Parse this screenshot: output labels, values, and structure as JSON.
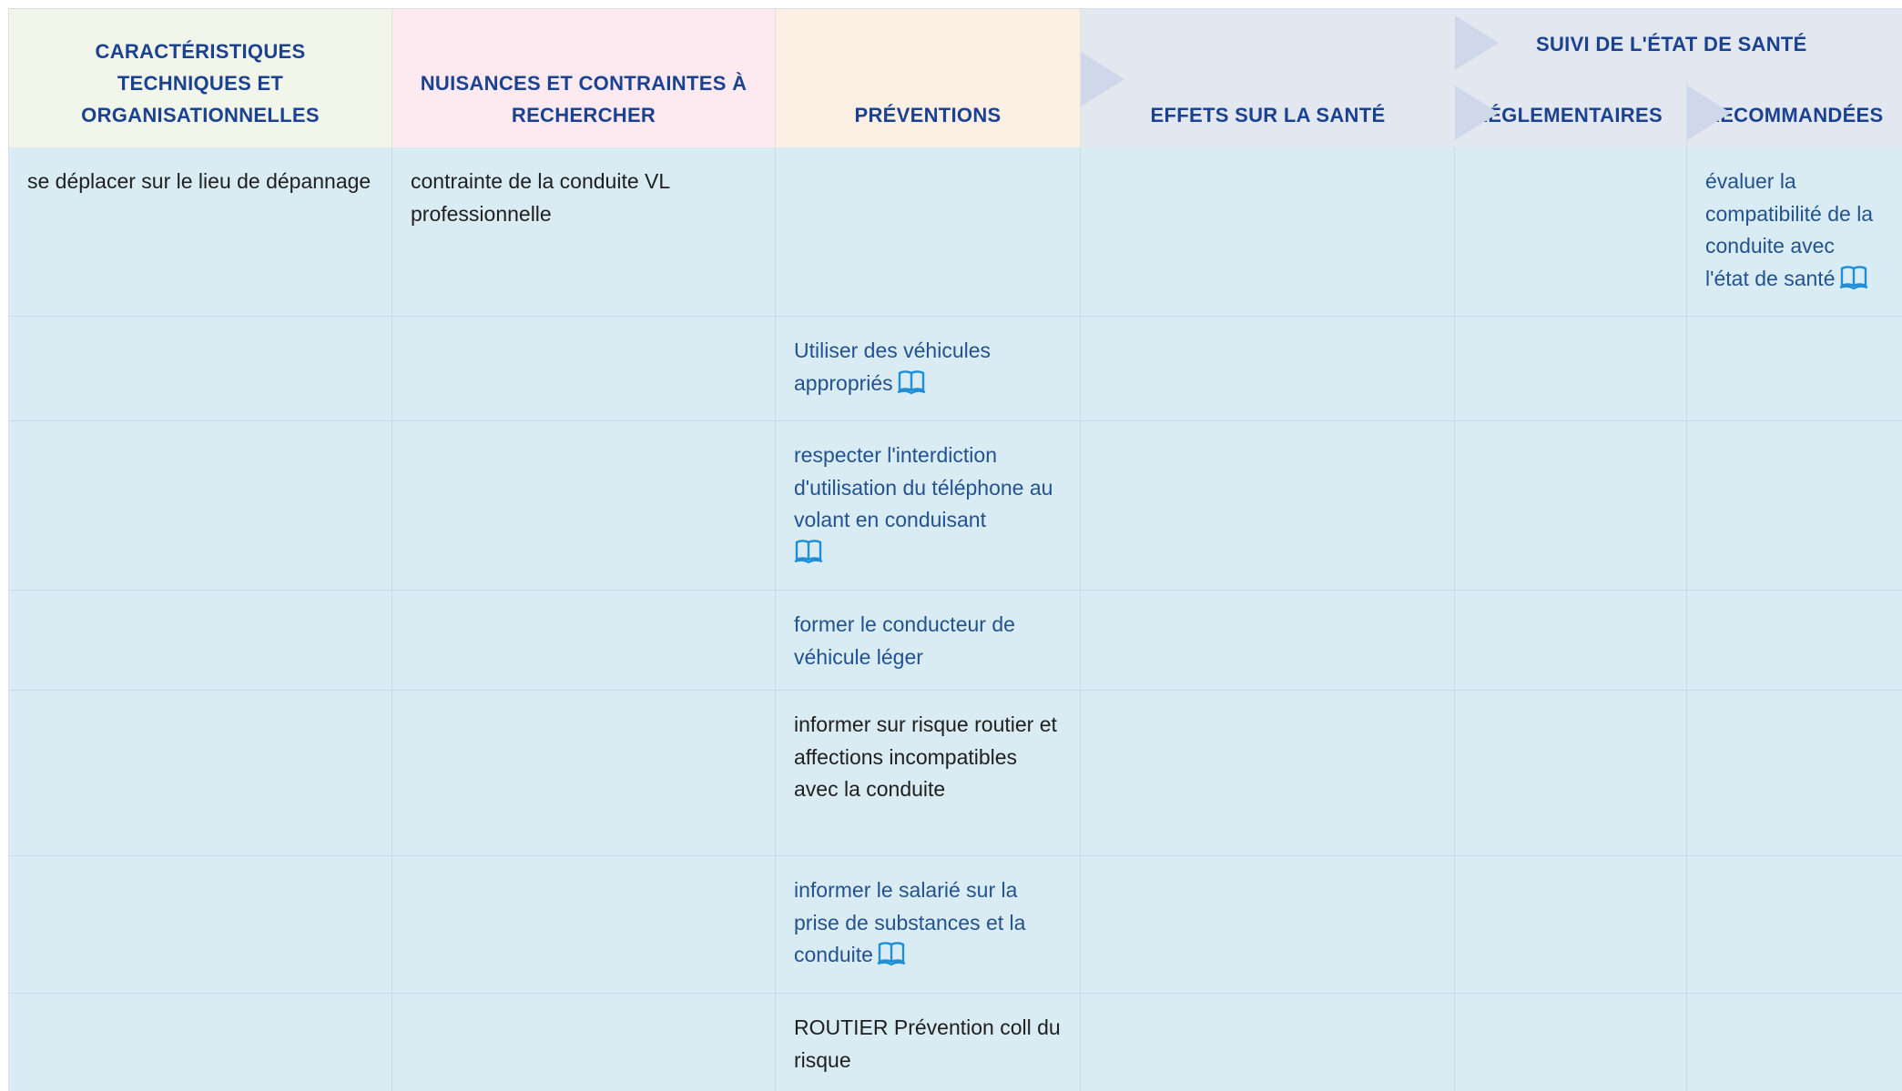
{
  "headers": {
    "col1": "CARACTÉRISTIQUES TECHNIQUES ET ORGANISATIONNELLES",
    "col2": "NUISANCES ET CONTRAINTES À RECHERCHER",
    "col3": "PRÉVENTIONS",
    "col4": "EFFETS SUR LA SANTÉ",
    "group": "SUIVI DE L'ÉTAT DE SANTÉ",
    "col5": "RÉGLEMENTAIRES",
    "col6": "RECOMMANDÉES"
  },
  "colors": {
    "header_text": "#1a4290",
    "col1_header_bg": "#f2f5ea",
    "col2_header_bg": "#fdeaf0",
    "col3_header_bg": "#fcefe4",
    "group_header_bg": "#e3e7ef",
    "body_bg": "#daecf3",
    "link_text": "#23528f",
    "plain_text": "#1f1f1f",
    "book_icon": "#1e8fd6"
  },
  "rows": [
    {
      "characteristic": "se déplacer sur le lieu de dépannage",
      "nuisance": "contrainte de la conduite VL professionnelle",
      "prevention": "",
      "effects": "",
      "regulatory": "",
      "recommended": "évaluer la compatibilité de la conduite avec l'état de santé",
      "recommended_icon": "book-icon"
    },
    {
      "characteristic": "",
      "nuisance": "",
      "prevention": "Utiliser des véhicules appropriés",
      "prevention_icon": "book-icon",
      "effects": "",
      "regulatory": "",
      "recommended": ""
    },
    {
      "characteristic": "",
      "nuisance": "",
      "prevention": "respecter l'interdiction d'utilisation du téléphone au volant en conduisant",
      "prevention_icon": "book-icon",
      "effects": "",
      "regulatory": "",
      "recommended": ""
    },
    {
      "characteristic": "",
      "nuisance": "",
      "prevention": "former le conducteur de véhicule léger",
      "effects": "",
      "regulatory": "",
      "recommended": ""
    },
    {
      "characteristic": "",
      "nuisance": "",
      "prevention": "informer sur risque routier et affections incompatibles avec la conduite",
      "effects": "",
      "regulatory": "",
      "recommended": ""
    },
    {
      "characteristic": "",
      "nuisance": "",
      "prevention": "informer le salarié sur la prise de substances et la conduite",
      "prevention_icon": "book-icon",
      "effects": "",
      "regulatory": "",
      "recommended": ""
    },
    {
      "characteristic": "",
      "nuisance": "",
      "prevention": "ROUTIER Prévention coll du risque",
      "effects": "",
      "regulatory": "",
      "recommended": ""
    }
  ]
}
